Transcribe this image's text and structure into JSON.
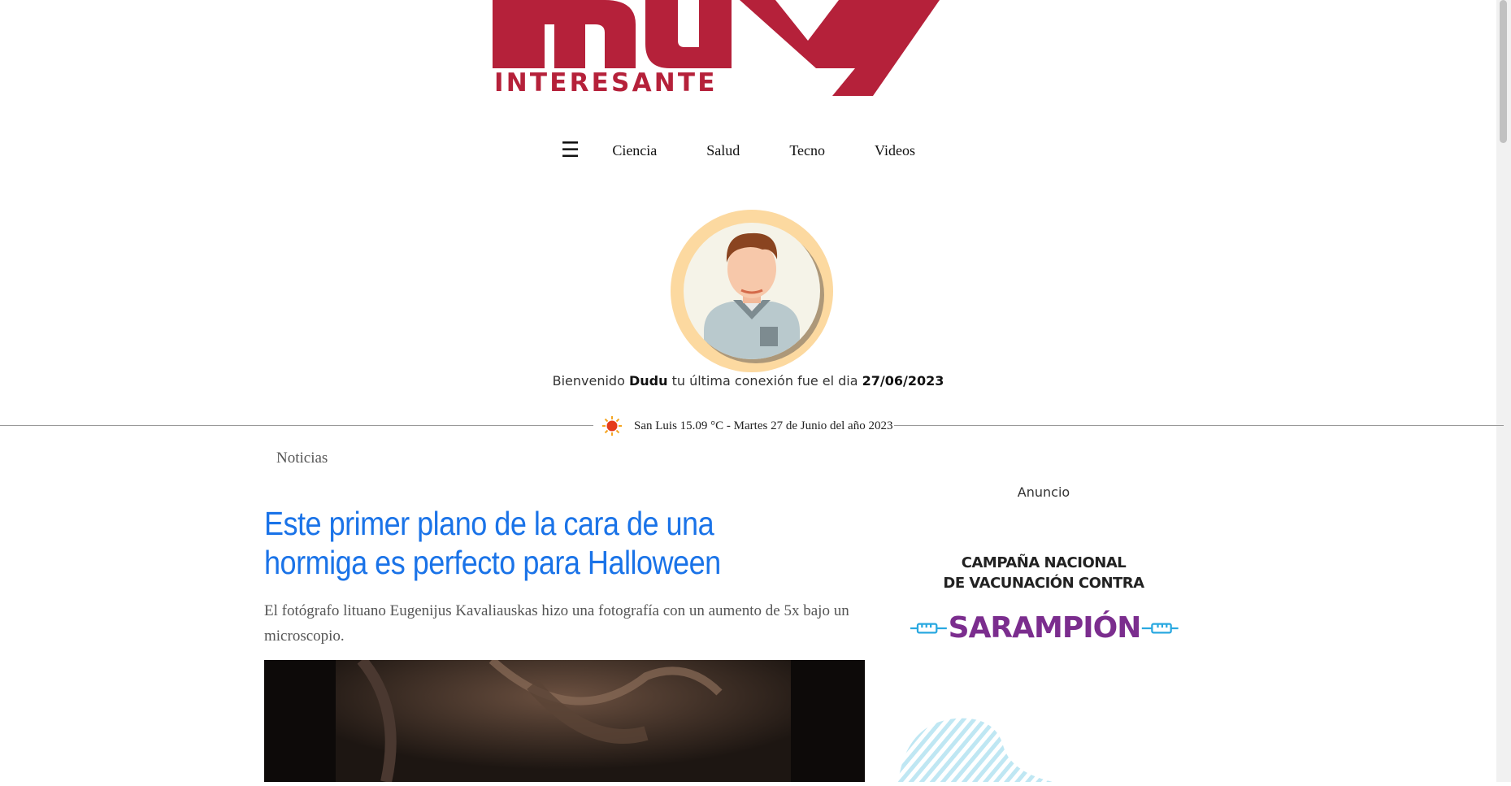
{
  "logo": {
    "top_text": "muy",
    "bottom_text": "INTERESANTE",
    "color": "#b5213a"
  },
  "nav": {
    "menu_icon": "☰",
    "items": [
      "Ciencia",
      "Salud",
      "Tecno",
      "Videos"
    ]
  },
  "user": {
    "welcome_prefix": "Bienvenido",
    "name": "Dudu",
    "welcome_middle": "tu última conexión fue el dia",
    "last_login": "27/06/2023"
  },
  "weather": {
    "icon": "sun-icon",
    "text": "San Luis 15.09 °C - Martes 27 de Junio del año 2023"
  },
  "article": {
    "section": "Noticias",
    "title": "Este primer plano de la cara de una hormiga es perfecto para Halloween",
    "summary": "El fotógrafo lituano Eugenijus Kavaliauskas hizo una fotografía con un aumento de 5x bajo un microscopio.",
    "title_color": "#1a73e8"
  },
  "ad": {
    "label": "Anuncio",
    "line1": "CAMPAÑA NACIONAL",
    "line2": "DE VACUNACIÓN CONTRA",
    "highlight": "SARAMPIÓN",
    "highlight_color": "#7b2d8e",
    "accent_color": "#29a8e0"
  }
}
